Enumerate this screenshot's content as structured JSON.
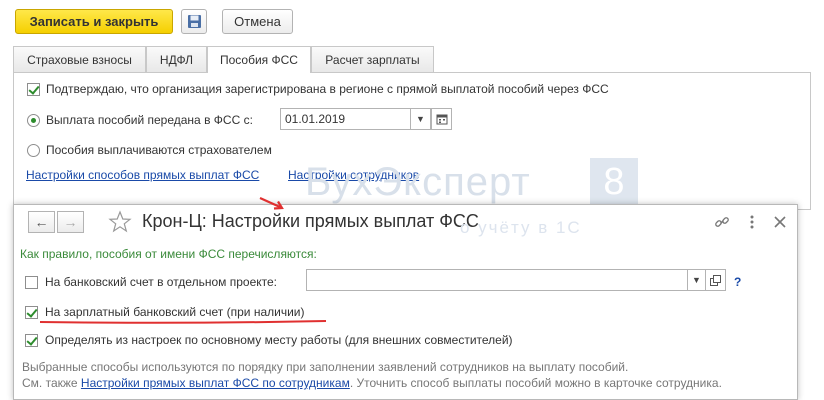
{
  "toolbar": {
    "save_close_label": "Записать и закрыть",
    "cancel_label": "Отмена"
  },
  "tabs": [
    {
      "label": "Страховые взносы",
      "active": false
    },
    {
      "label": "НДФЛ",
      "active": false
    },
    {
      "label": "Пособия ФСС",
      "active": true
    },
    {
      "label": "Расчет зарплаты",
      "active": false
    }
  ],
  "fss_panel": {
    "confirm_label": "Подтверждаю, что организация зарегистрирована в регионе с прямой выплатой пособий через ФСС",
    "confirm_checked": true,
    "option_transferred_label": "Выплата пособий передана в ФСС с:",
    "transfer_date": "01.01.2019",
    "option_employer_label": "Пособия выплачиваются страхователем",
    "selected_option": "transferred",
    "link_payment_settings": "Настройки способов прямых выплат ФСС",
    "link_employee_settings": "Настройки сотрудников"
  },
  "watermark": {
    "brand_text": "БухЭксперт",
    "brand_digit": "8",
    "sub_text": "о учёту в 1С"
  },
  "popup": {
    "title": "Крон-Ц: Настройки прямых выплат ФСС",
    "intro": "Как правило, пособия от имени ФСС перечисляются:",
    "bank_project_label": "На банковский счет в отдельном проекте:",
    "bank_project_checked": false,
    "bank_project_value": "",
    "help_label": "?",
    "salary_account_label": "На зарплатный банковский счет (при наличии)",
    "salary_account_checked": true,
    "main_workplace_label": "Определять из настроек по основному месту работы (для внешних совместителей)",
    "main_workplace_checked": true,
    "note_line1": "Выбранные способы используются по порядку при заполнении заявлений сотрудников на выплату пособий.",
    "note_line2_prefix": "См. также",
    "note_line2_link": "Настройки прямых выплат ФСС по сотрудникам",
    "note_line2_suffix": ". Уточнить способ выплаты пособий можно в карточке сотрудника."
  },
  "colors": {
    "primary_button": "#f5cf00",
    "link": "#1a4aa8",
    "check": "#2d8c2d",
    "annotation_red": "#e03030"
  }
}
